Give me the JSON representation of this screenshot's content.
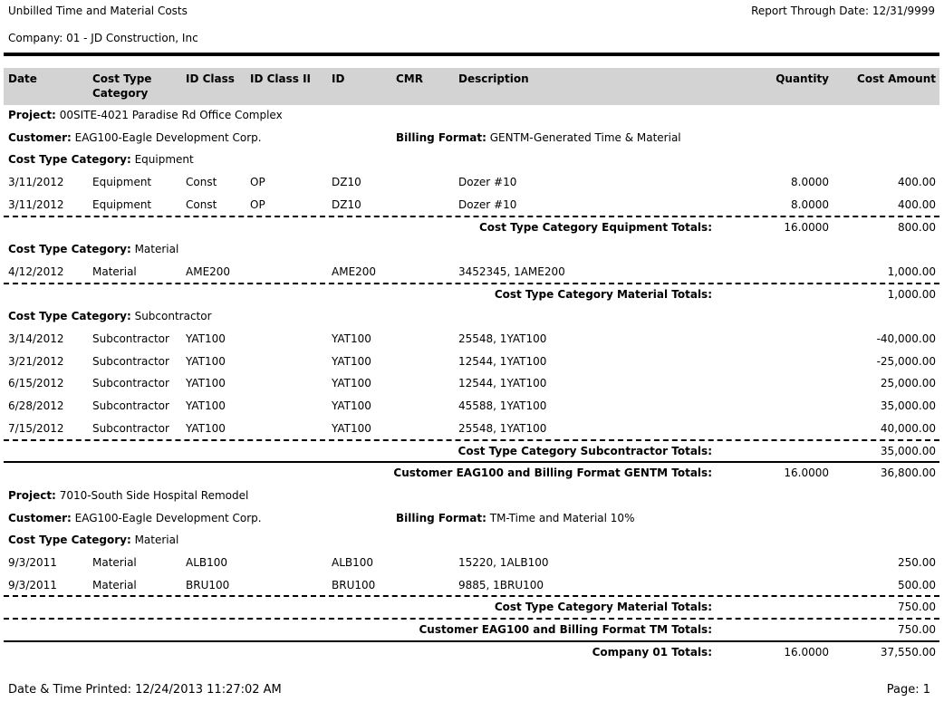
{
  "report": {
    "title": "Unbilled Time and Material Costs",
    "through_date": "Report Through Date: 12/31/9999",
    "company": "Company: 01 - JD Construction, Inc"
  },
  "columns": {
    "date": "Date",
    "category_l1": "Cost Type",
    "category_l2": "Category",
    "idclass": "ID Class",
    "idclass2": "ID Class II",
    "id": "ID",
    "cmr": "CMR",
    "description": "Description",
    "quantity": "Quantity",
    "cost": "Cost Amount"
  },
  "labels": {
    "project": "Project:",
    "customer": "Customer:",
    "billing_format": "Billing Format:",
    "cost_type_category": "Cost Type Category:"
  },
  "projects": [
    {
      "project": "00SITE-4021 Paradise Rd Office Complex",
      "customer": "EAG100-Eagle Development Corp.",
      "billing_format": "GENTM-Generated Time & Material",
      "groups": [
        {
          "category": "Equipment",
          "rows": [
            {
              "date": "3/11/2012",
              "cat": "Equipment",
              "idclass": "Const",
              "idclass2": "OP",
              "id": "DZ10",
              "cmr": "",
              "desc": "Dozer #10",
              "qty": "8.0000",
              "amount": "400.00"
            },
            {
              "date": "3/11/2012",
              "cat": "Equipment",
              "idclass": "Const",
              "idclass2": "OP",
              "id": "DZ10",
              "cmr": "",
              "desc": "Dozer #10",
              "qty": "8.0000",
              "amount": "400.00"
            }
          ],
          "total_label": "Cost Type Category Equipment Totals:",
          "total_qty": "16.0000",
          "total_amount": "800.00"
        },
        {
          "category": "Material",
          "rows": [
            {
              "date": "4/12/2012",
              "cat": "Material",
              "idclass": "AME200",
              "idclass2": "",
              "id": "AME200",
              "cmr": "",
              "desc": "3452345, 1AME200",
              "qty": "",
              "amount": "1,000.00"
            }
          ],
          "total_label": "Cost Type Category Material Totals:",
          "total_qty": "",
          "total_amount": "1,000.00"
        },
        {
          "category": "Subcontractor",
          "rows": [
            {
              "date": "3/14/2012",
              "cat": "Subcontractor",
              "idclass": "YAT100",
              "idclass2": "",
              "id": "YAT100",
              "cmr": "",
              "desc": "25548, 1YAT100",
              "qty": "",
              "amount": "-40,000.00"
            },
            {
              "date": "3/21/2012",
              "cat": "Subcontractor",
              "idclass": "YAT100",
              "idclass2": "",
              "id": "YAT100",
              "cmr": "",
              "desc": "12544, 1YAT100",
              "qty": "",
              "amount": "-25,000.00"
            },
            {
              "date": "6/15/2012",
              "cat": "Subcontractor",
              "idclass": "YAT100",
              "idclass2": "",
              "id": "YAT100",
              "cmr": "",
              "desc": "12544, 1YAT100",
              "qty": "",
              "amount": "25,000.00"
            },
            {
              "date": "6/28/2012",
              "cat": "Subcontractor",
              "idclass": "YAT100",
              "idclass2": "",
              "id": "YAT100",
              "cmr": "",
              "desc": "45588, 1YAT100",
              "qty": "",
              "amount": "35,000.00"
            },
            {
              "date": "7/15/2012",
              "cat": "Subcontractor",
              "idclass": "YAT100",
              "idclass2": "",
              "id": "YAT100",
              "cmr": "",
              "desc": "25548, 1YAT100",
              "qty": "",
              "amount": "40,000.00"
            }
          ],
          "total_label": "Cost Type Category Subcontractor Totals:",
          "total_qty": "",
          "total_amount": "35,000.00"
        }
      ],
      "customer_total_label": "Customer EAG100 and Billing Format GENTM Totals:",
      "customer_total_qty": "16.0000",
      "customer_total_amount": "36,800.00"
    },
    {
      "project": "7010-South Side Hospital Remodel",
      "customer": "EAG100-Eagle Development Corp.",
      "billing_format": "TM-Time and Material 10%",
      "groups": [
        {
          "category": "Material",
          "rows": [
            {
              "date": "9/3/2011",
              "cat": "Material",
              "idclass": "ALB100",
              "idclass2": "",
              "id": "ALB100",
              "cmr": "",
              "desc": "15220, 1ALB100",
              "qty": "",
              "amount": "250.00"
            },
            {
              "date": "9/3/2011",
              "cat": "Material",
              "idclass": "BRU100",
              "idclass2": "",
              "id": "BRU100",
              "cmr": "",
              "desc": "9885, 1BRU100",
              "qty": "",
              "amount": "500.00"
            }
          ],
          "total_label": "Cost Type Category Material Totals:",
          "total_qty": "",
          "total_amount": "750.00"
        }
      ],
      "customer_total_label": "Customer EAG100 and Billing Format TM Totals:",
      "customer_total_qty": "",
      "customer_total_amount": "750.00"
    }
  ],
  "company_total": {
    "label": "Company 01 Totals:",
    "qty": "16.0000",
    "amount": "37,550.00"
  },
  "footer": {
    "printed": "Date & Time Printed: 12/24/2013 11:27:02 AM",
    "page": "Page: 1"
  }
}
